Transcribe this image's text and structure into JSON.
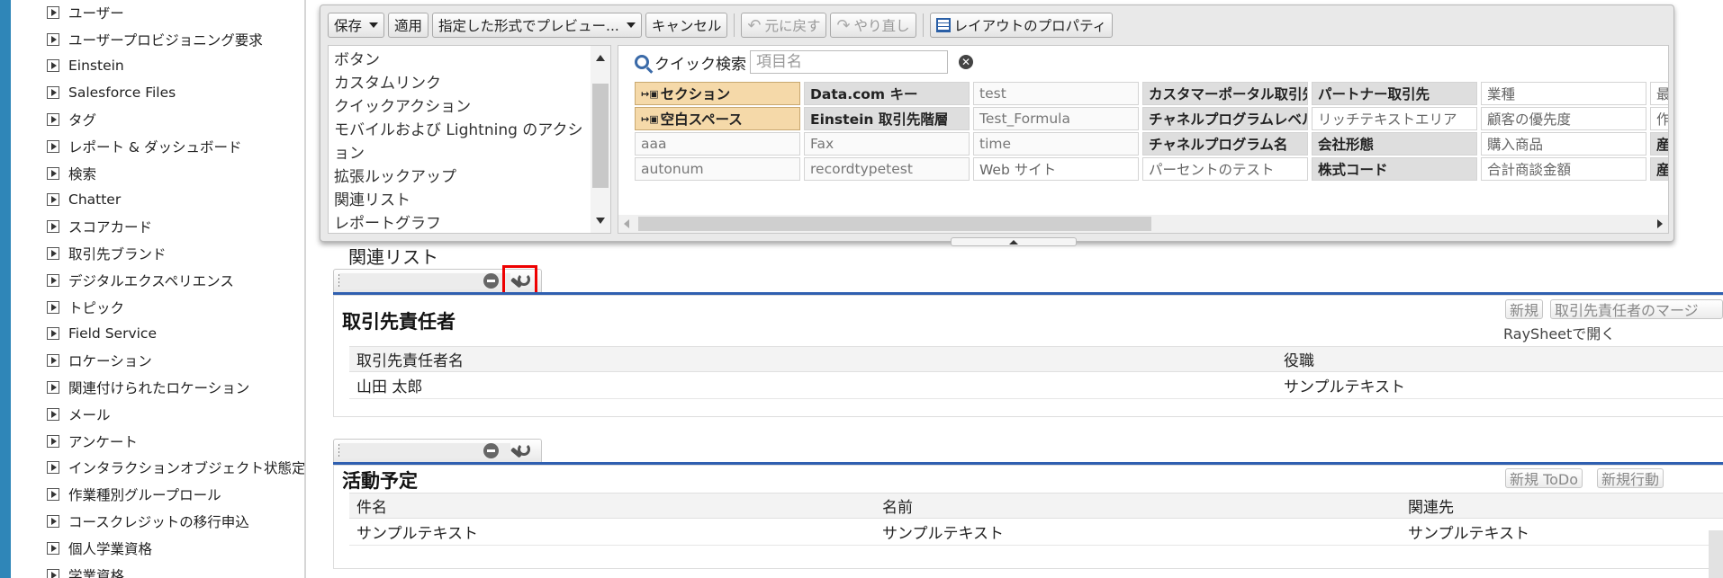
{
  "sidebar": {
    "items": [
      "ユーザー",
      "ユーザープロビジョニング要求",
      "Einstein",
      "Salesforce Files",
      "タグ",
      "レポート & ダッシュボード",
      "検索",
      "Chatter",
      "スコアカード",
      "取引先ブランド",
      "デジタルエクスペリエンス",
      "トピック",
      "Field Service",
      "ロケーション",
      "関連付けられたロケーション",
      "メール",
      "アンケート",
      "インタラクションオブジェクト状態定義",
      "作業種別グループロール",
      "コースクレジットの移行申込",
      "個人学業資格",
      "学業資格"
    ]
  },
  "toolbar": {
    "save": "保存",
    "apply": "適用",
    "preview": "指定した形式でプレビュー...",
    "cancel": "キャンセル",
    "undo": "元に戻す",
    "redo": "やり直し",
    "layout_props": "レイアウトのプロパティ"
  },
  "categories": [
    "ボタン",
    "カスタムリンク",
    "クイックアクション",
    "モバイルおよび Lightning のアクション",
    "拡張ルックアップ",
    "関連リスト",
    "レポートグラフ"
  ],
  "quick_search": {
    "label": "クイック検索",
    "placeholder": "項目名"
  },
  "fields": {
    "row1": [
      "セクション",
      "Data.com キー",
      "test",
      "カスタマーポータル取引先",
      "パートナー取引先",
      "業種",
      "最"
    ],
    "row2": [
      "空白スペース",
      "Einstein 取引先階層",
      "Test_Formula",
      "チャネルプログラムレベル名",
      "リッチテキストエリア",
      "顧客の優先度",
      "作"
    ],
    "row3": [
      "aaa",
      "Fax",
      "time",
      "チャネルプログラム名",
      "会社形態",
      "購入商品",
      "産"
    ],
    "row4": [
      "autonum",
      "recordtypetest",
      "Web サイト",
      "パーセントのテスト",
      "株式コード",
      "合計商談金額",
      "産"
    ]
  },
  "related": {
    "heading": "関連リスト",
    "contacts": {
      "title": "取引先責任者",
      "btn_new": "新規",
      "btn_merge": "取引先責任者のマージ",
      "raysheet": "RaySheetで開く",
      "columns": [
        "取引先責任者名",
        "役職"
      ],
      "row": [
        "山田 太郎",
        "サンプルテキスト"
      ]
    },
    "activities": {
      "title": "活動予定",
      "btn_todo": "新規 ToDo",
      "btn_event": "新規行動",
      "columns": [
        "件名",
        "名前",
        "関連先"
      ],
      "row": [
        "サンプルテキスト",
        "サンプルテキスト",
        "サンプルテキスト"
      ]
    }
  },
  "colors": {
    "accent": "#2f86b8",
    "section_line": "#2f5fb0",
    "special_field": "#f5d9a9",
    "highlight": "#ee0000"
  }
}
